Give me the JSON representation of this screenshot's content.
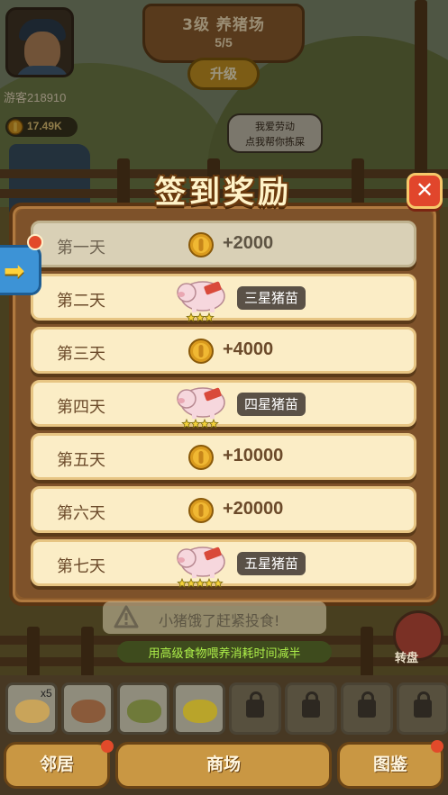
{
  "hud": {
    "username": "游客218910",
    "coins": "17.49K",
    "level_title": "3级 养猪场",
    "level_progress": "5/5",
    "upgrade_label": "升级",
    "speech": [
      "我爱劳动",
      "点我帮你拣屎"
    ]
  },
  "signin": {
    "title": "签到奖励",
    "close_symbol": "✕",
    "side_arrow": "➡",
    "rows": [
      {
        "day": "第一天",
        "reward_type": "coin",
        "amount": "+2000",
        "claimed": true
      },
      {
        "day": "第二天",
        "reward_type": "pig",
        "badge": "三星猪苗",
        "stars": 3
      },
      {
        "day": "第三天",
        "reward_type": "coin",
        "amount": "+4000"
      },
      {
        "day": "第四天",
        "reward_type": "pig",
        "badge": "四星猪苗",
        "stars": 4
      },
      {
        "day": "第五天",
        "reward_type": "coin",
        "amount": "+10000"
      },
      {
        "day": "第六天",
        "reward_type": "coin",
        "amount": "+20000"
      },
      {
        "day": "第七天",
        "reward_type": "pig",
        "badge": "五星猪苗",
        "stars": 5
      }
    ]
  },
  "status": {
    "warning": "小猪饿了赶紧投食!",
    "hint": "用高级食物喂养消耗时间减半",
    "daruma_label": "转盘"
  },
  "inventory": {
    "first_count": "x5",
    "slots": [
      {
        "type": "food",
        "color": "#c9a45a"
      },
      {
        "type": "food",
        "color": "#8a5a3a"
      },
      {
        "type": "food",
        "color": "#6f7a3a"
      },
      {
        "type": "food",
        "color": "#b9a42a"
      },
      {
        "type": "locked"
      },
      {
        "type": "locked"
      },
      {
        "type": "locked"
      },
      {
        "type": "locked"
      }
    ]
  },
  "nav": {
    "neighbors": "邻居",
    "shop": "商场",
    "guide": "图鉴"
  },
  "colors": {
    "accent_gold": "#e7c583",
    "close_red": "#e1462c",
    "hint_green": "#aef04a"
  }
}
